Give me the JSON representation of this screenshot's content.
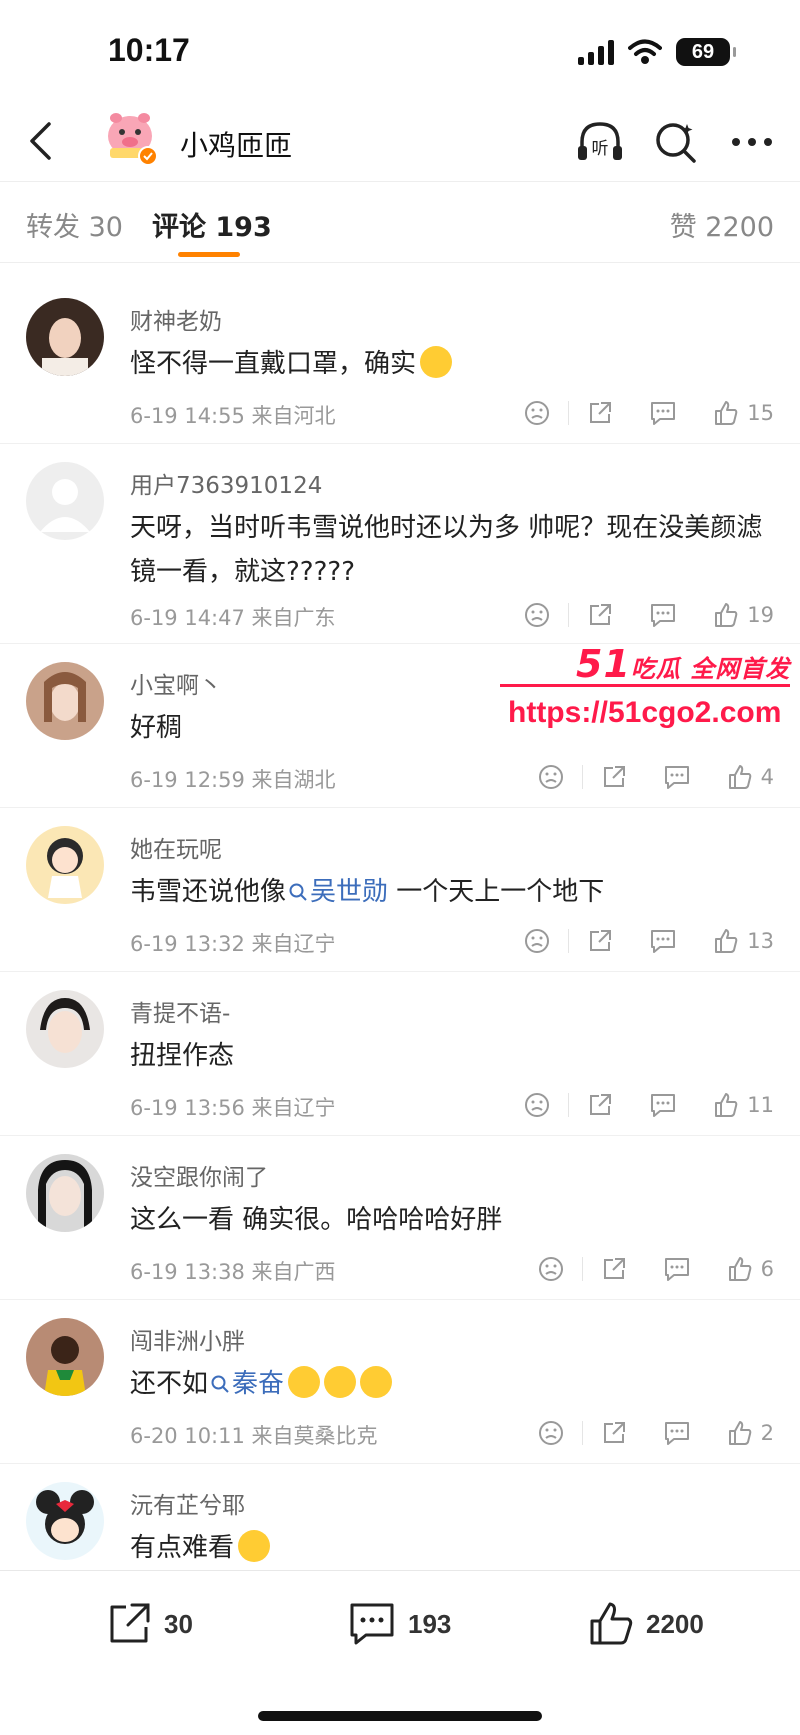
{
  "status_bar": {
    "time": "10:17",
    "battery": "69"
  },
  "header": {
    "title": "小鸡匝匝",
    "listen_label": "听"
  },
  "tabs": [
    {
      "label": "转发 30"
    },
    {
      "label": "评论 193"
    },
    {
      "label": "赞 2200"
    }
  ],
  "comments": [
    {
      "name": "财神老奶",
      "text": "怪不得一直戴口罩，确实",
      "time": "6-19 14:55",
      "location": "来自河北",
      "likes": "15"
    },
    {
      "name": "用户7363910124",
      "text": "天呀，当时听韦雪说他时还以为多 帅呢？现在没美颜滤镜一看，就这?????",
      "time": "6-19 14:47",
      "location": "来自广东",
      "likes": "19"
    },
    {
      "name": "小宝啊丶",
      "text": "好稠",
      "time": "6-19 12:59",
      "location": "来自湖北",
      "likes": "4"
    },
    {
      "name": "她在玩呢",
      "text_before": "韦雪还说他像",
      "mention": "吴世勋",
      "text_after": " 一个天上一个地下",
      "time": "6-19 13:32",
      "location": "来自辽宁",
      "likes": "13"
    },
    {
      "name": "青提不语-",
      "text": "扭捏作态",
      "time": "6-19 13:56",
      "location": "来自辽宁",
      "likes": "11"
    },
    {
      "name": "没空跟你闹了",
      "text": "这么一看 确实很。哈哈哈哈好胖",
      "time": "6-19 13:38",
      "location": "来自广西",
      "likes": "6"
    },
    {
      "name": "闯非洲小胖",
      "text_before": "还不如",
      "mention": "秦奋",
      "time": "6-20 10:11",
      "location": "来自莫桑比克",
      "likes": "2"
    },
    {
      "name": "沅有芷兮耶",
      "text": "有点难看"
    }
  ],
  "watermark": {
    "brand_num": "51",
    "brand_text": "吃瓜 全网首发",
    "url": "https://51cgo2.com"
  },
  "bottom_bar": {
    "repost_count": "30",
    "comment_count": "193",
    "like_count": "2200"
  },
  "colors": {
    "accent": "#ff8200",
    "mention": "#3c6dbb",
    "watermark": "#ff1a4a"
  }
}
